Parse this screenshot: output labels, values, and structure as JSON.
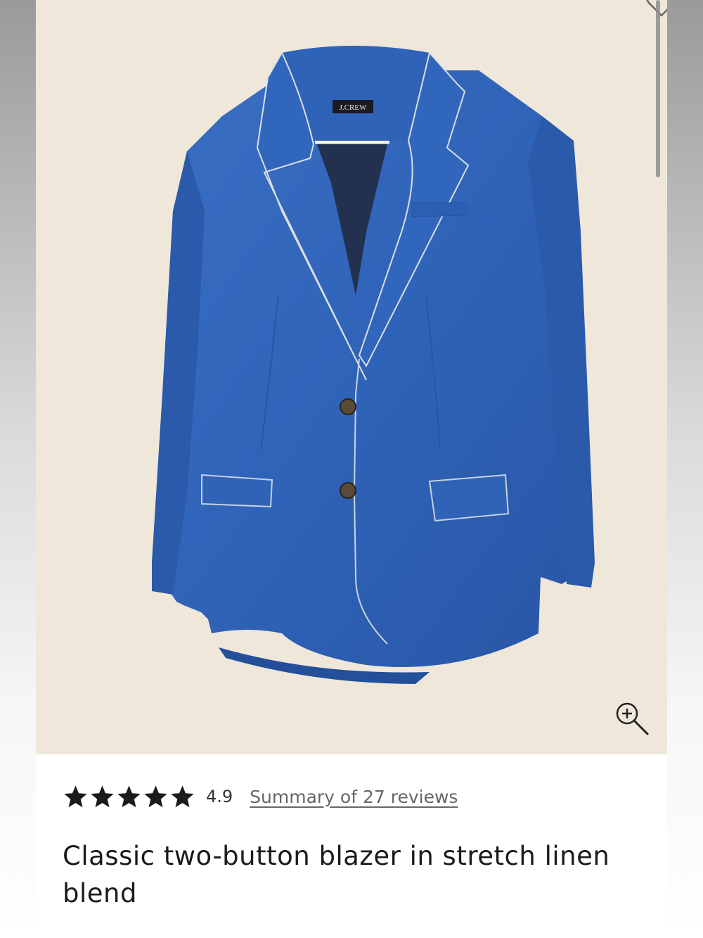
{
  "product": {
    "brand_label": "J.CREW",
    "title": "Classic two-button blazer in stretch linen blend",
    "jacket_color": "#2f63b8",
    "lining_color": "#23304f",
    "image_background": "#efe7da"
  },
  "rating": {
    "stars": 5,
    "value": "4.9",
    "reviews_link": "Summary of 27 reviews"
  },
  "icons": {
    "favorite": "heart-outline-icon",
    "zoom": "zoom-in-icon",
    "star": "star-icon"
  }
}
